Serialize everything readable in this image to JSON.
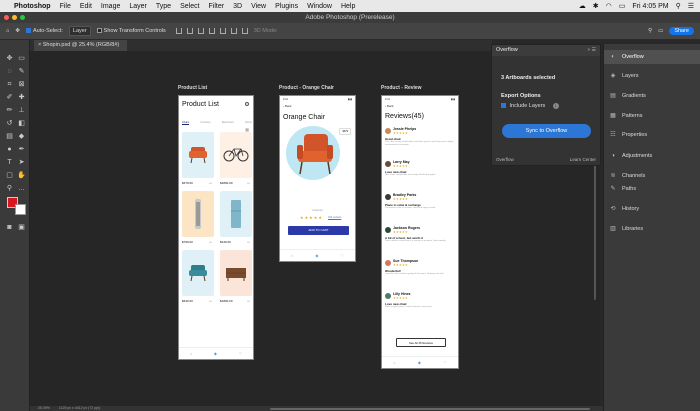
{
  "menubar": {
    "app": "Photoshop",
    "items": [
      "File",
      "Edit",
      "Image",
      "Layer",
      "Type",
      "Select",
      "Filter",
      "3D",
      "View",
      "Plugins",
      "Window",
      "Help"
    ],
    "clock": "Fri 4:05 PM"
  },
  "window": {
    "title": "Adobe Photoshop (Prerelease)"
  },
  "options": {
    "auto_select_label": "Auto-Select:",
    "auto_select_value": "Layer",
    "transform_label": "Show Transform Controls",
    "mode_label": "3D Mode:",
    "share_label": "Share"
  },
  "document": {
    "tab_label": "Shopin.psd @ 25.4% (RGB/8#)",
    "zoom": "25.39%",
    "doc_info": "1125 px x 4412 px (72 ppi)"
  },
  "artboards": {
    "product_list": {
      "label": "Product List",
      "title": "Product List",
      "categories": [
        "Chairs",
        "Furniture",
        "Electronics",
        "Decor"
      ],
      "cards": [
        {
          "price": "$679.00",
          "color": "#dff1f7"
        },
        {
          "price": "$2800.00",
          "color": "#fff0e6"
        },
        {
          "price": "$799.00",
          "color": "#fbe5c4"
        },
        {
          "price": "$249.00",
          "color": "#dff1f7"
        },
        {
          "price": "$630.00",
          "color": "#dff1f7"
        },
        {
          "price": "$1800.00",
          "color": "#fbe5d8"
        }
      ]
    },
    "orange_chair": {
      "label": "Product - Orange Chair",
      "time": "9:41",
      "back": "Back",
      "title": "Orange Chair",
      "price": "$679",
      "featured": "Featured",
      "reviews_link": "314 reviews",
      "button": "ADD TO CART"
    },
    "review": {
      "label": "Product - Review",
      "time": "9:41",
      "back": "Back",
      "title": "Reviews(45)",
      "stars": "★★★★★",
      "reviews": [
        {
          "name": "Jessie Phelps",
          "headline": "Great chair",
          "text": "This chair is very comfortable and looks great in my living room. Highly recommend to everyone.",
          "avatar": "#c98a5a"
        },
        {
          "name": "Larry May",
          "headline": "Love new chair",
          "text": "Nice chair, comfortable and sturdy. Would buy again.",
          "avatar": "#6b4a3a"
        },
        {
          "name": "Bradley Parks",
          "headline": "Place to relax & recharge",
          "text": "The perfect chair to sit back, relax and enjoy a book.",
          "avatar": "#3a3a3a"
        },
        {
          "name": "Jackson Rogers",
          "headline": "A bit of a hunt, but worth it",
          "text": "Took a while to arrive but it is exactly as pictured. Great quality.",
          "avatar": "#2e4a3a"
        },
        {
          "name": "Sue Thompson",
          "headline": "Wonderful!",
          "text": "Love the color and the quality of this piece. Delivery was fast.",
          "avatar": "#d9765a"
        },
        {
          "name": "Lilly Hines",
          "headline": "Love new chair",
          "text": "Such a stylish piece. Looks fantastic in my room.",
          "avatar": "#4a7a6a"
        }
      ],
      "see_all": "See All 45 Reviews"
    }
  },
  "overflow_panel": {
    "tab": "Overflow",
    "selected": "3 Artboards selected",
    "export_options": "Export Options",
    "include_layers": "Include Layers",
    "sync_button": "Sync to Overflow",
    "footer_left": "Overflow",
    "footer_right": "Learn Center"
  },
  "right_panel": {
    "items": [
      {
        "label": "Overflow",
        "icon": "overflow-icon"
      },
      {
        "label": "Layers",
        "icon": "layers-icon"
      },
      {
        "label": "Gradients",
        "icon": "gradients-icon"
      },
      {
        "label": "Patterns",
        "icon": "patterns-icon"
      },
      {
        "label": "Properties",
        "icon": "properties-icon"
      },
      {
        "label": "Adjustments",
        "icon": "adjustments-icon"
      },
      {
        "label": "Channels",
        "icon": "channels-icon"
      },
      {
        "label": "Paths",
        "icon": "paths-icon"
      },
      {
        "label": "History",
        "icon": "history-icon"
      },
      {
        "label": "Libraries",
        "icon": "libraries-icon"
      }
    ]
  }
}
